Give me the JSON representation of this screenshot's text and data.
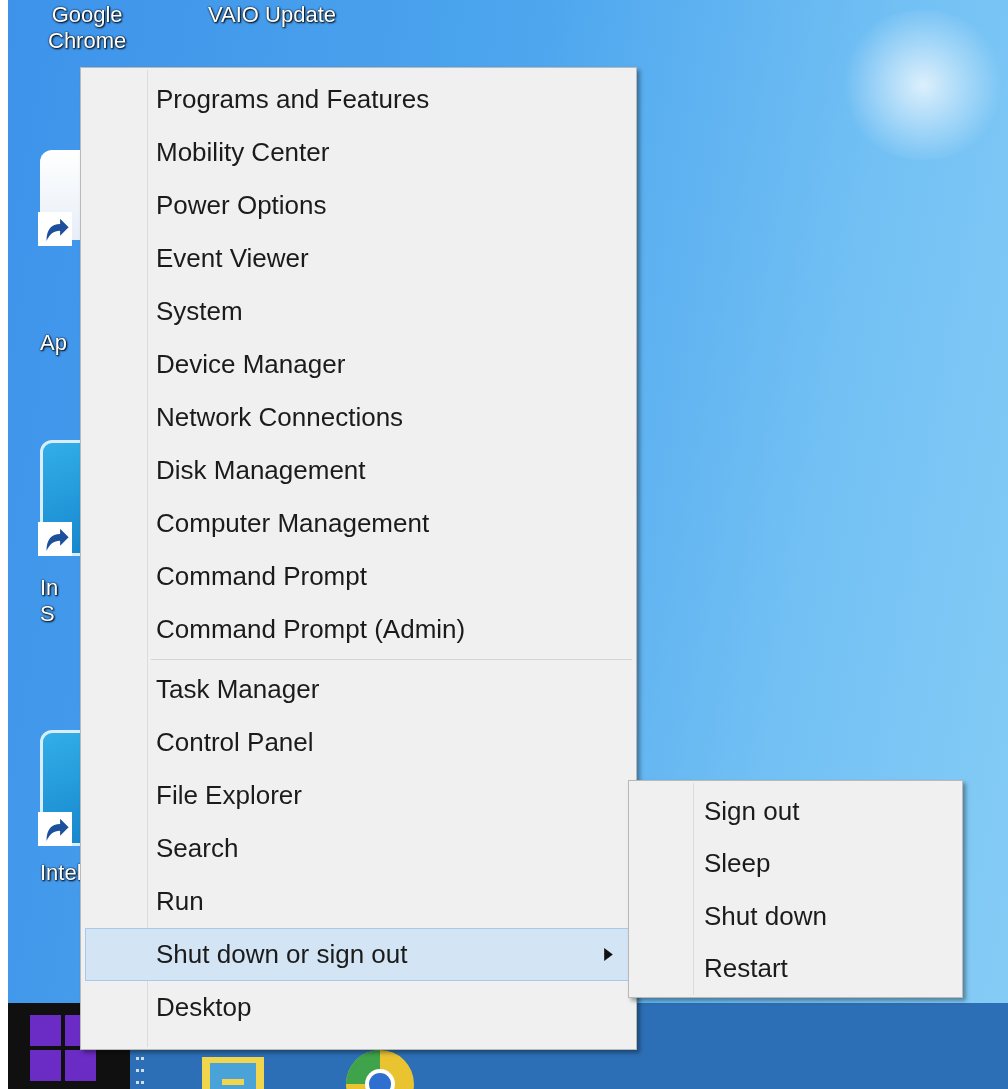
{
  "desktop_icons": [
    {
      "kind": "top",
      "lines": [
        "Google",
        "Chrome"
      ]
    },
    {
      "kind": "top",
      "lines": [
        "VAIO Update"
      ]
    },
    {
      "kind": "side",
      "lines": [
        "Ap"
      ]
    },
    {
      "kind": "side",
      "lines": [
        "In",
        "S"
      ]
    },
    {
      "kind": "side",
      "lines": [
        "Intel"
      ]
    }
  ],
  "context_menu": {
    "groups": [
      [
        {
          "label": "Programs and Features",
          "selected": false
        },
        {
          "label": "Mobility Center",
          "selected": false
        },
        {
          "label": "Power Options",
          "selected": false
        },
        {
          "label": "Event Viewer",
          "selected": false
        },
        {
          "label": "System",
          "selected": false
        },
        {
          "label": "Device Manager",
          "selected": false
        },
        {
          "label": "Network Connections",
          "selected": false
        },
        {
          "label": "Disk Management",
          "selected": false
        },
        {
          "label": "Computer Management",
          "selected": false
        },
        {
          "label": "Command Prompt",
          "selected": false
        },
        {
          "label": "Command Prompt (Admin)",
          "selected": false
        }
      ],
      [
        {
          "label": "Task Manager",
          "selected": false
        },
        {
          "label": "Control Panel",
          "selected": false
        },
        {
          "label": "File Explorer",
          "selected": false
        },
        {
          "label": "Search",
          "selected": false
        },
        {
          "label": "Run",
          "selected": false
        },
        {
          "label": "Shut down or sign out",
          "selected": true,
          "has_submenu": true
        },
        {
          "label": "Desktop",
          "selected": false
        }
      ]
    ]
  },
  "submenu": {
    "items": [
      {
        "label": "Sign out"
      },
      {
        "label": "Sleep"
      },
      {
        "label": "Shut down"
      },
      {
        "label": "Restart"
      }
    ]
  }
}
